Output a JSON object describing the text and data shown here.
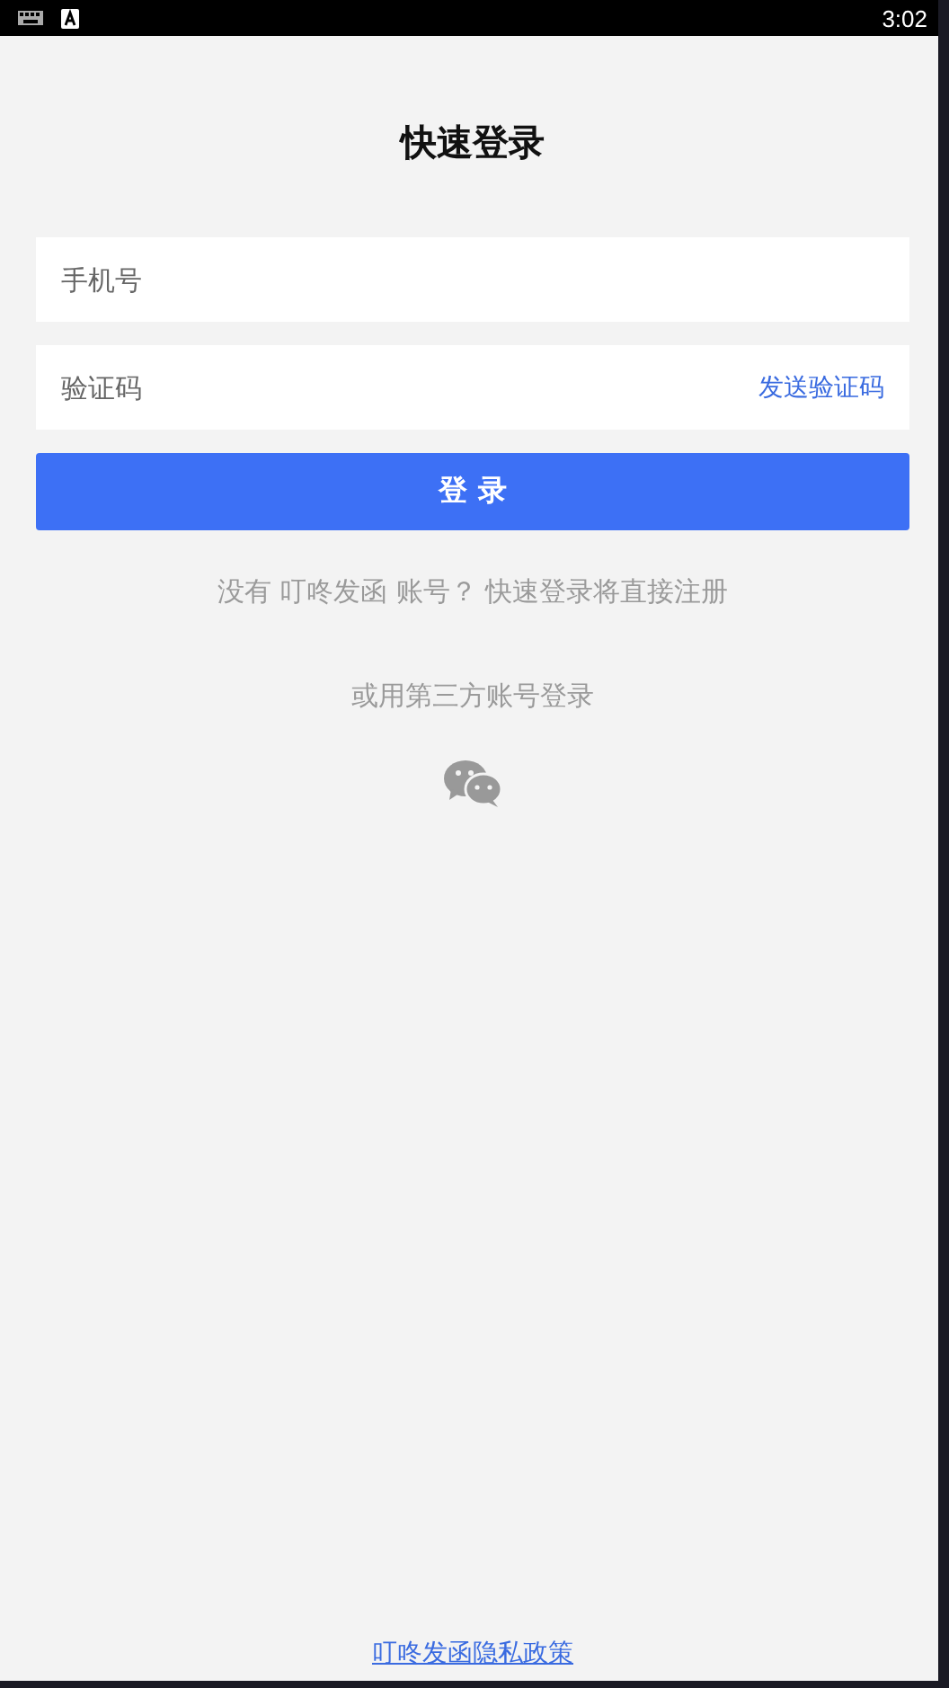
{
  "status_bar": {
    "time": "3:02"
  },
  "title": "快速登录",
  "phone_field": {
    "placeholder": "手机号"
  },
  "code_field": {
    "placeholder": "验证码",
    "action": "发送验证码"
  },
  "login_button": "登 录",
  "register_hint": "没有 叮咚发函 账号？ 快速登录将直接注册",
  "third_party_label": "或用第三方账号登录",
  "privacy_link": "叮咚发函隐私政策"
}
